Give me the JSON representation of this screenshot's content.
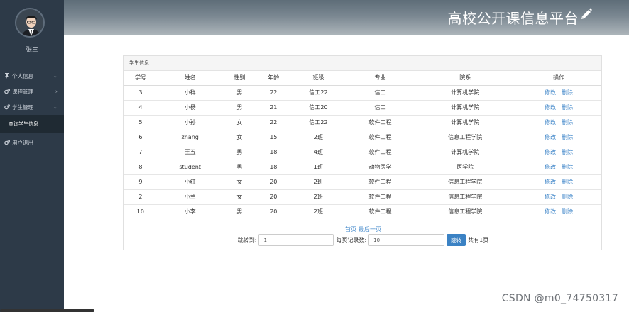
{
  "sidebar": {
    "username": "张三",
    "items": [
      {
        "label": "个人信息",
        "icon": "pin-icon",
        "chevron": "⌄"
      },
      {
        "label": "课程管理",
        "icon": "cogs-icon",
        "chevron": "›"
      },
      {
        "label": "学生管理",
        "icon": "cogs-icon",
        "chevron": "⌄"
      }
    ],
    "submenu": {
      "label": "查询学生信息"
    },
    "logout": {
      "label": "用户退出",
      "icon": "cogs-icon"
    }
  },
  "header": {
    "title": "高校公开课信息平台",
    "icon": "pencil-icon"
  },
  "panel": {
    "title": "学生信息",
    "columns": [
      "学号",
      "姓名",
      "性别",
      "年龄",
      "班级",
      "专业",
      "院系",
      "操作"
    ],
    "rows": [
      [
        "3",
        "小祥",
        "男",
        "22",
        "信工22",
        "信工",
        "计算机学院"
      ],
      [
        "4",
        "小杨",
        "男",
        "21",
        "信工20",
        "信工",
        "计算机学院"
      ],
      [
        "5",
        "小孙",
        "女",
        "22",
        "信工22",
        "软件工程",
        "计算机学院"
      ],
      [
        "6",
        "zhang",
        "女",
        "15",
        "2班",
        "软件工程",
        "信息工程学院"
      ],
      [
        "7",
        "王五",
        "男",
        "18",
        "4班",
        "软件工程",
        "计算机学院"
      ],
      [
        "8",
        "student",
        "男",
        "18",
        "1班",
        "动物医学",
        "医学院"
      ],
      [
        "9",
        "小红",
        "女",
        "20",
        "2班",
        "软件工程",
        "信息工程学院"
      ],
      [
        "2",
        "小兰",
        "女",
        "20",
        "2班",
        "软件工程",
        "信息工程学院"
      ],
      [
        "10",
        "小李",
        "男",
        "20",
        "2班",
        "软件工程",
        "信息工程学院"
      ]
    ],
    "edit_label": "修改",
    "delete_label": "删除"
  },
  "pager": {
    "first": "首页",
    "last": "最后一页",
    "jump_label": "跳转到:",
    "jump_value": "1",
    "page_size_label": "每页记录数:",
    "page_size_value": "10",
    "jump_button": "跳转",
    "total": "共有1页"
  },
  "watermark": "CSDN @m0_74750317",
  "colors": {
    "sidebar": "#2d3a48",
    "accent": "#3b82c4",
    "link": "#3c84c8"
  }
}
